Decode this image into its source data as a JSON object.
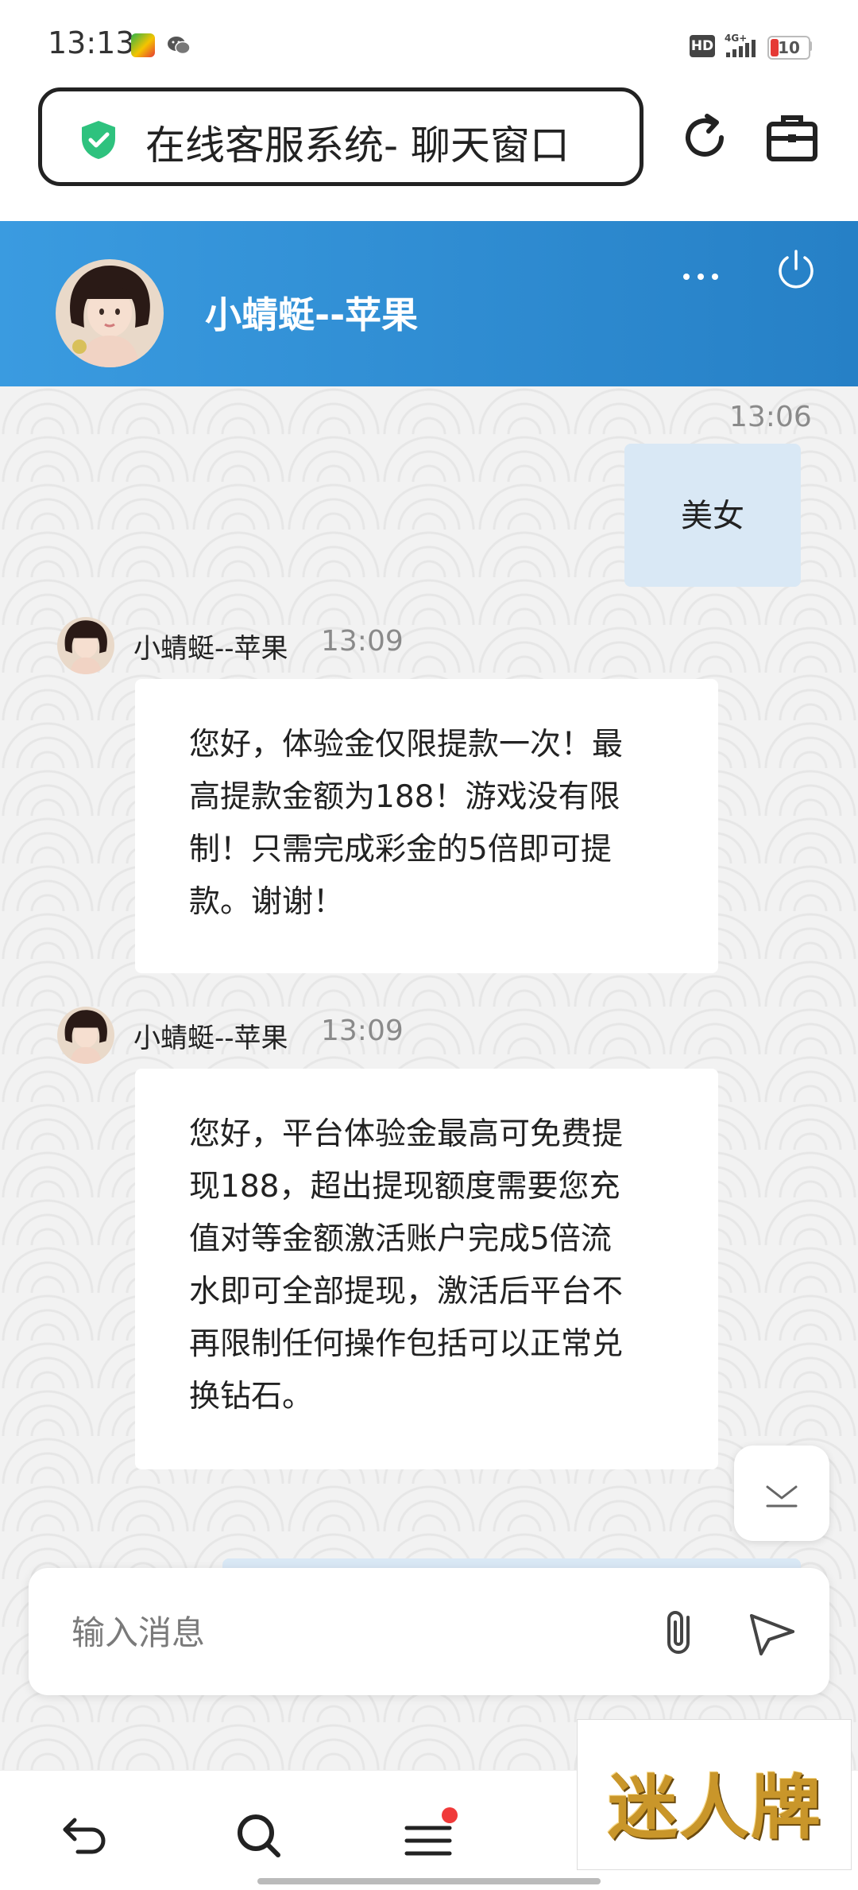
{
  "status_bar": {
    "time": "13:13",
    "hd_label": "HD",
    "battery": "10",
    "icons": [
      "app-icon",
      "wechat-icon",
      "signal-4g-icon",
      "battery-icon"
    ]
  },
  "browser": {
    "title": "在线客服系统- 聊天窗口",
    "icons": [
      "shield-check-icon",
      "reload-icon",
      "toolbox-icon"
    ],
    "accent_color": "#2ec27e"
  },
  "chat_header": {
    "agent_name": "小蜻蜓--苹果",
    "background_color": "#2f8fd6",
    "icons": [
      "more-icon",
      "power-icon"
    ]
  },
  "messages": [
    {
      "direction": "out",
      "time": "13:06",
      "text": "美女"
    },
    {
      "direction": "in",
      "sender": "小蜻蜓--苹果",
      "time": "13:09",
      "lines": [
        "您好，体验金仅限提款一次！最",
        "高提款金额为188！游戏没有限",
        "制！只需完成彩金的5倍即可提",
        "款。谢谢！"
      ]
    },
    {
      "direction": "in",
      "sender": "小蜻蜓--苹果",
      "time": "13:09",
      "lines": [
        "您好，平台体验金最高可免费提",
        "现188，超出提现额度需要您充",
        "值对等金额激活账户完成5倍流",
        "水即可全部提现，激活后平台不",
        "再限制任何操作包括可以正常兑",
        "换钻石。"
      ]
    }
  ],
  "composer": {
    "placeholder": "输入消息",
    "icons": [
      "paperclip-icon",
      "send-icon"
    ]
  },
  "bottom_nav": {
    "items": [
      "back-icon",
      "search-icon",
      "menu-icon"
    ],
    "notification_dot_color": "#f03a3a"
  },
  "brand": {
    "text": "迷人牌"
  }
}
